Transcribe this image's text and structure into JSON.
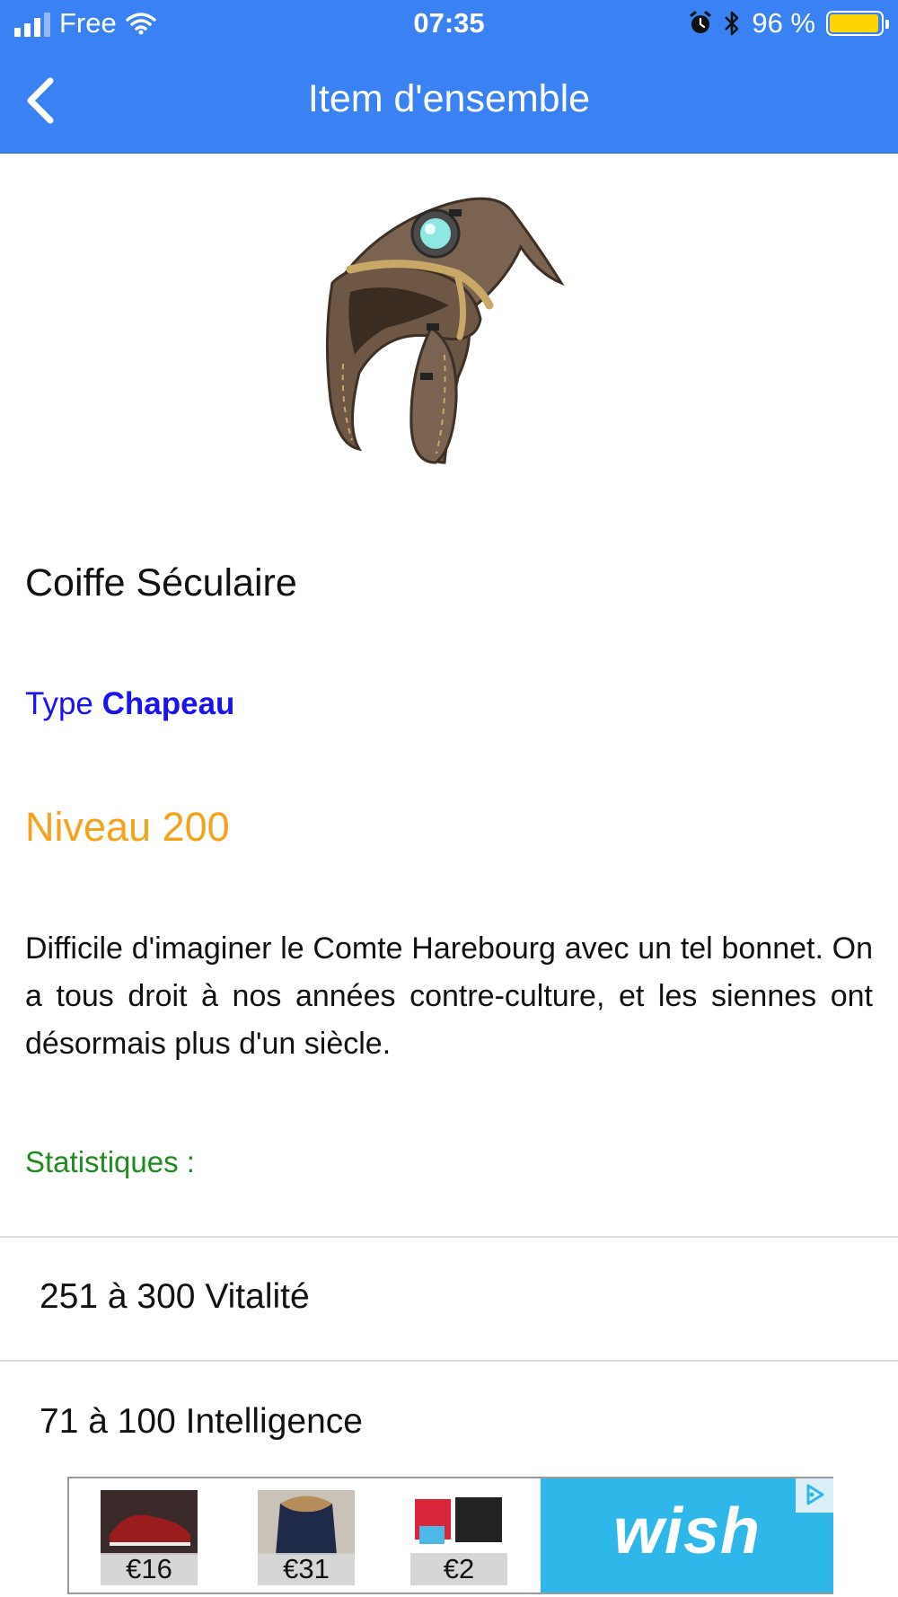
{
  "status_bar": {
    "carrier": "Free",
    "time": "07:35",
    "battery_percent": "96 %",
    "battery_level": 0.96,
    "icons": [
      "signal-icon",
      "wifi-icon",
      "alarm-icon",
      "bluetooth-icon",
      "battery-icon"
    ]
  },
  "header": {
    "title": "Item d'ensemble",
    "back_icon": "chevron-left-icon"
  },
  "item": {
    "image_icon": "hat-item-image",
    "name": "Coiffe Séculaire",
    "type_label": "Type",
    "type_value": "Chapeau",
    "level": "Niveau 200",
    "description": "Difficile d'imaginer le Comte Harebourg avec un tel bonnet. On a tous droit à nos années contre-culture, et les siennes ont désormais plus d'un siècle.",
    "stats_label": "Statistiques :",
    "stats": [
      "251 à 300 Vitalité",
      "71 à 100 Intelligence"
    ]
  },
  "ad": {
    "products": [
      {
        "price": "€16",
        "icon": "shoe-product-image"
      },
      {
        "price": "€31",
        "icon": "jacket-product-image"
      },
      {
        "price": "€2",
        "icon": "organizer-product-image"
      }
    ],
    "brand": "wish",
    "adchoices_icon": "adchoices-icon"
  },
  "colors": {
    "header_bg": "#3a82f3",
    "type_color": "#1a12f0",
    "level_color": "#f7a21b",
    "stats_label_color": "#1f8a1f",
    "wish_bg": "#2fb7ea",
    "battery_fill": "#ffd400"
  }
}
